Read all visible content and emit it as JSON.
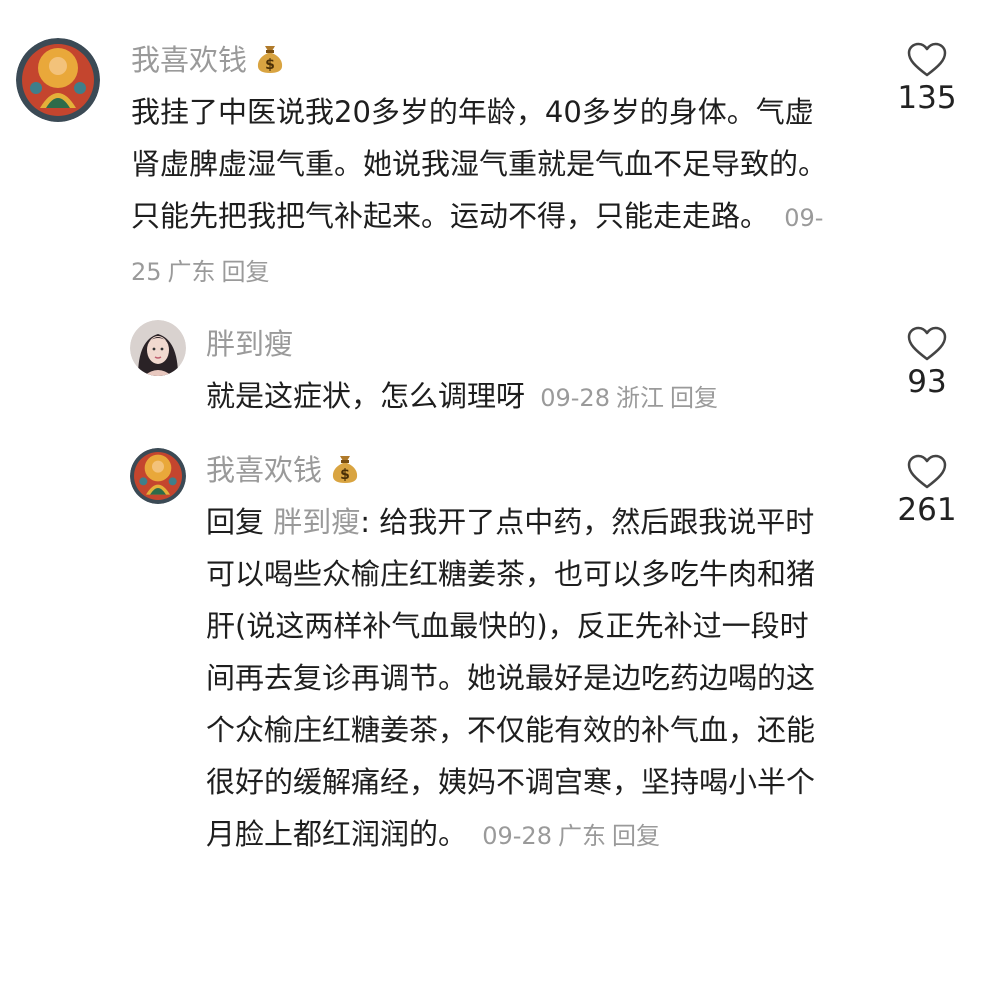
{
  "colors": {
    "muted": "#9a9a9a",
    "text": "#1e1e1e",
    "background": "#ffffff"
  },
  "comments": [
    {
      "username": "我喜欢钱",
      "badge_icon": "money-bag-icon",
      "avatar_icon": "buddha-thangka-avatar",
      "text": "我挂了中医说我20多岁的年龄，40多岁的身体。气虚肾虚脾虚湿气重。她说我湿气重就是气血不足导致的。只能先把我把气补起来。运动不得，只能走走路。",
      "date": "09-25",
      "location": "广东",
      "reply_label": "回复",
      "likes": "135"
    },
    {
      "username": "胖到瘦",
      "avatar_icon": "woman-portrait-avatar",
      "text": "就是这症状，怎么调理呀",
      "date": "09-28",
      "location": "浙江",
      "reply_label": "回复",
      "likes": "93"
    },
    {
      "username": "我喜欢钱",
      "badge_icon": "money-bag-icon",
      "avatar_icon": "buddha-thangka-avatar",
      "reply_prefix": "回复",
      "reply_to": "胖到瘦",
      "text": ": 给我开了点中药，然后跟我说平时可以喝些众榆庄红糖姜茶，也可以多吃牛肉和猪肝(说这两样补气血最快的)，反正先补过一段时间再去复诊再调节。她说最好是边吃药边喝的这个众榆庄红糖姜茶，不仅能有效的补气血，还能很好的缓解痛经，姨妈不调宫寒，坚持喝小半个月脸上都红润润的。",
      "date": "09-28",
      "location": "广东",
      "reply_label": "回复",
      "likes": "261"
    }
  ]
}
